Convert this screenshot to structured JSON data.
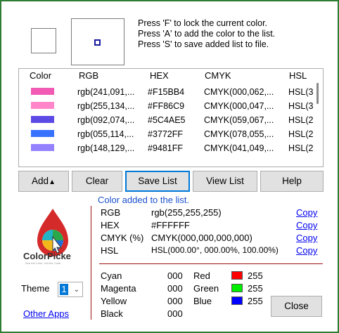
{
  "hints": [
    "Press 'F' to lock the current color.",
    "Press 'A' to add the color to the list.",
    "Press 'S' to save added list to file."
  ],
  "table": {
    "headers": [
      "Color",
      "RGB",
      "HEX",
      "CMYK",
      "HSL"
    ],
    "rows": [
      {
        "color": "#F15BB4",
        "rgb": "rgb(241,091,...",
        "hex": "#F15BB4",
        "cmyk": "CMYK(000,062,...",
        "hsl": "HSL(3"
      },
      {
        "color": "#FF86C9",
        "rgb": "rgb(255,134,...",
        "hex": "#FF86C9",
        "cmyk": "CMYK(000,047,...",
        "hsl": "HSL(3"
      },
      {
        "color": "#5C4AE5",
        "rgb": "rgb(092,074,...",
        "hex": "#5C4AE5",
        "cmyk": "CMYK(059,067,...",
        "hsl": "HSL(2"
      },
      {
        "color": "#3772FF",
        "rgb": "rgb(055,114,...",
        "hex": "#3772FF",
        "cmyk": "CMYK(078,055,...",
        "hsl": "HSL(2"
      },
      {
        "color": "#9481FF",
        "rgb": "rgb(148,129,...",
        "hex": "#9481FF",
        "cmyk": "CMYK(041,049,...",
        "hsl": "HSL(2"
      }
    ]
  },
  "buttons": {
    "add": "Add",
    "clear": "Clear",
    "save_list": "Save List",
    "view_list": "View List",
    "help": "Help",
    "close": "Close"
  },
  "logo": {
    "text": "ColorPicke",
    "tagline": "See the Color. Get the Code."
  },
  "status": "Color added to the list.",
  "details": {
    "rgb_label": "RGB",
    "rgb_value": "rgb(255,255,255)",
    "hex_label": "HEX",
    "hex_value": "#FFFFFF",
    "cmyk_label": "CMYK (%)",
    "cmyk_value": "CMYK(000,000,000,000)",
    "hsl_label": "HSL",
    "hsl_value": "HSL(000.00°, 000.00%, 100.00%)",
    "copy": "Copy"
  },
  "cmyk_breakdown": {
    "cyan_label": "Cyan",
    "cyan": "000",
    "magenta_label": "Magenta",
    "magenta": "000",
    "yellow_label": "Yellow",
    "yellow": "000",
    "black_label": "Black",
    "black": "000"
  },
  "rgb_breakdown": {
    "red_label": "Red",
    "red": "255",
    "red_color": "#ff0000",
    "green_label": "Green",
    "green": "255",
    "green_color": "#00ee00",
    "blue_label": "Blue",
    "blue": "255",
    "blue_color": "#0000ff"
  },
  "theme": {
    "label": "Theme",
    "value": "1"
  },
  "other_apps": "Other Apps"
}
